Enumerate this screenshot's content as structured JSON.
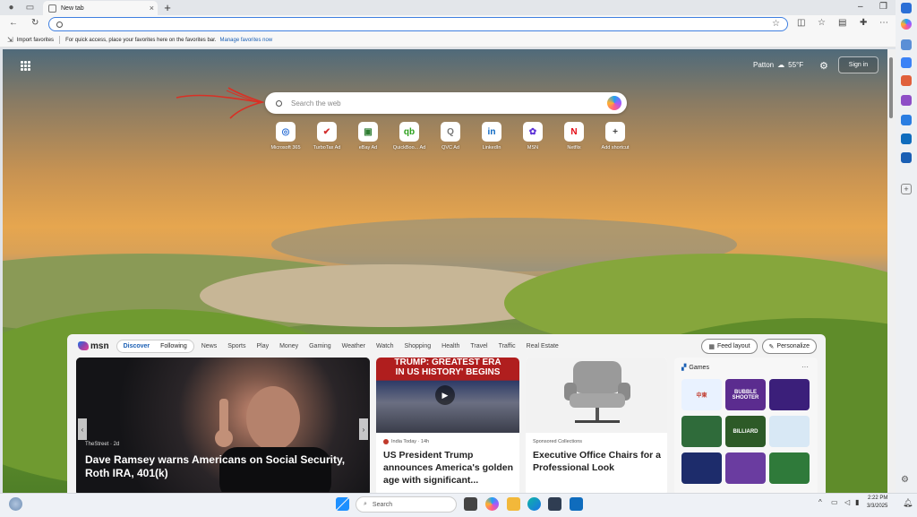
{
  "browser": {
    "tab_title": "New tab",
    "tab_close": "×",
    "new_tab": "+",
    "address_value": "",
    "favorites_bar": {
      "import_label": "Import favorites",
      "hint_text": "For quick access, place your favorites here on the favorites bar.",
      "manage_link": "Manage favorites now"
    }
  },
  "newtab": {
    "weather": {
      "location": "Patton",
      "temperature": "55°F"
    },
    "sign_in_label": "Sign in",
    "search_placeholder": "Search the web",
    "shortcuts": [
      {
        "label": "Microsoft 365",
        "icon": "microsoft365-icon",
        "glyph": "◎",
        "color": "#2b6fd6"
      },
      {
        "label": "TurboTax  Ad",
        "icon": "turbotax-icon",
        "glyph": "✔",
        "color": "#d32f2f"
      },
      {
        "label": "eBay  Ad",
        "icon": "ebay-bag-icon",
        "glyph": "▣",
        "color": "#2e7d32"
      },
      {
        "label": "QuickBoo...  Ad",
        "icon": "quickbooks-icon",
        "glyph": "qb",
        "color": "#2ca01c"
      },
      {
        "label": "QVC  Ad",
        "icon": "qvc-icon",
        "glyph": "Q",
        "color": "#777777"
      },
      {
        "label": "LinkedIn",
        "icon": "linkedin-icon",
        "glyph": "in",
        "color": "#0a66c2"
      },
      {
        "label": "MSN",
        "icon": "msn-icon",
        "glyph": "✿",
        "color": "#5b2fd6"
      },
      {
        "label": "Netflix",
        "icon": "netflix-icon",
        "glyph": "N",
        "color": "#e50914"
      },
      {
        "label": "Add shortcut",
        "icon": "plus-icon",
        "glyph": "+",
        "color": "#444444"
      }
    ]
  },
  "feed": {
    "brand": "msn",
    "segments": [
      "Discover",
      "Following"
    ],
    "categories": [
      "News",
      "Sports",
      "Play",
      "Money",
      "Gaming",
      "Weather",
      "Watch",
      "Shopping",
      "Health",
      "Travel",
      "Traffic",
      "Real Estate"
    ],
    "feed_layout_label": "Feed layout",
    "personalize_label": "Personalize",
    "main_story": {
      "source": "TheStreet · 2d",
      "headline": "Dave Ramsey warns Americans on Social Security, Roth IRA, 401(k)"
    },
    "story2": {
      "banner_line1": "TRUMP: GREATEST ERA",
      "banner_line2": "IN US HISTORY' BEGINS",
      "source": "India Today · 14h",
      "headline": "US President Trump announces America's golden age with significant..."
    },
    "story3": {
      "source": "Sponsored Collections",
      "headline": "Executive Office Chairs for a Professional Look"
    },
    "games": {
      "title": "Games",
      "more": "···",
      "tiles": [
        {
          "name": "mahjong",
          "label": "中東"
        },
        {
          "name": "bubble-shooter",
          "label": "BUBBLE SHOOTER"
        },
        {
          "name": "paper-plane",
          "label": ""
        },
        {
          "name": "mahjong-tiles",
          "label": ""
        },
        {
          "name": "billiards",
          "label": "BILLIARD"
        },
        {
          "name": "monopoly-man",
          "label": ""
        },
        {
          "name": "tetris",
          "label": ""
        },
        {
          "name": "candy",
          "label": ""
        },
        {
          "name": "solitaire",
          "label": ""
        }
      ]
    }
  },
  "taskbar": {
    "search_placeholder": "Search",
    "time": "2:22 PM",
    "date": "3/3/2025"
  },
  "colors": {
    "accent": "#1a5fb4",
    "address_border": "#3f7fe0",
    "annotation_arrow": "#d93025"
  }
}
